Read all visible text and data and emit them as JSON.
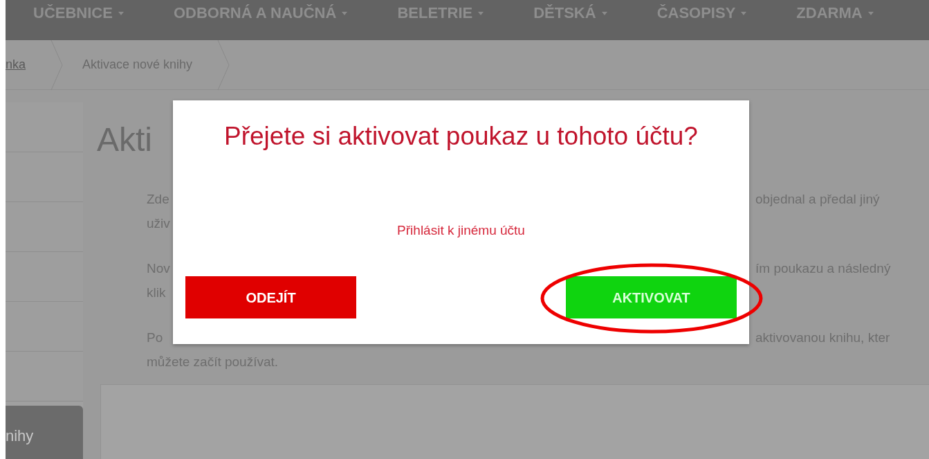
{
  "nav": {
    "items": [
      {
        "label": "UČEBNICE"
      },
      {
        "label": "ODBORNÁ A NAUČNÁ"
      },
      {
        "label": "BELETRIE"
      },
      {
        "label": "DĚTSKÁ"
      },
      {
        "label": "ČASOPISY"
      },
      {
        "label": "ZDARMA"
      }
    ]
  },
  "breadcrumb": [
    {
      "label": "nka",
      "kind": "link"
    },
    {
      "label": "Aktivace nové knihy",
      "kind": "current"
    }
  ],
  "sidebar": {
    "items": [
      {
        "selected": false
      },
      {
        "selected": false
      },
      {
        "selected": false
      },
      {
        "selected": false
      },
      {
        "selected": false
      },
      {
        "selected": false
      },
      {
        "label": "nihy",
        "selected": true
      }
    ]
  },
  "page": {
    "heading": "Akti",
    "paragraphs": [
      {
        "lines": [
          {
            "left": "Zde",
            "right": "objednal a předal jiný"
          },
          {
            "left": "uživ"
          }
        ]
      },
      {
        "lines": [
          {
            "left": "Nov",
            "right": "ím poukazu a následný"
          },
          {
            "left": "klik"
          }
        ]
      },
      {
        "lines": [
          {
            "left": "Po",
            "right": "aktivovanou knihu, kter"
          },
          {
            "left": "můžete začít používat."
          }
        ]
      }
    ]
  },
  "modal": {
    "title": "Přejete si aktivovat poukaz u tohoto účtu?",
    "link": "Přihlásit k jinému účtu",
    "buttons": [
      {
        "label": "ODEJÍT",
        "kind": "cancel",
        "highlighted": false
      },
      {
        "label": "AKTIVOVAT",
        "kind": "confirm",
        "highlighted": true
      }
    ]
  }
}
